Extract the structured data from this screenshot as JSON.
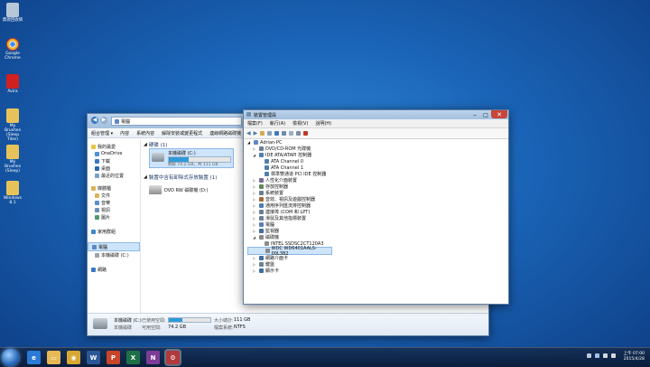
{
  "desktop": {
    "icons": [
      {
        "label": "資源回收筒",
        "color": "#b8c7d8"
      },
      {
        "label": "Google Chrome",
        "color": "#e8b52c"
      },
      {
        "label": "Avira",
        "color": "#d02020"
      },
      {
        "label": "My Brushes (Sleep Tiles)",
        "color": "#e6c35a"
      },
      {
        "label": "My Brushes (Sleep)",
        "color": "#e6c35a"
      },
      {
        "label": "Windows 8.1",
        "color": "#e6c35a"
      }
    ]
  },
  "explorer": {
    "address": "電腦",
    "toolbar": [
      "組合管理 ▾",
      "內容",
      "系統內容",
      "解除安裝或變更程式",
      "連線網路磁碟機"
    ],
    "nav": {
      "favorites": "我的最愛",
      "fav_items": [
        "OneDrive",
        "下載",
        "桌面",
        "最近的位置"
      ],
      "libraries": "媒體櫃",
      "lib_items": [
        "文件",
        "音樂",
        "視訊",
        "圖片"
      ],
      "homegroup": "家用群組",
      "computer": "電腦",
      "computer_items": [
        "本機磁碟 (C:)"
      ],
      "network": "網路"
    },
    "group_hdd": "硬碟 (1)",
    "drive_c": {
      "name": "本機磁碟 (C:)",
      "space": "剩餘 74.2 GB，共 111 GB",
      "used_fraction": 0.33
    },
    "group_removable": "裝置中含有卸除式存放裝置 (1)",
    "dvd": "DVD RW 磁碟機 (D:)",
    "details": {
      "name": "本機磁碟 (C:)",
      "subtitle": "本機磁碟",
      "used_label": "已使用空間:",
      "free_label": "可用空間:",
      "free_value": "74.2 GB",
      "total_label": "大小總計:",
      "total_value": "111 GB",
      "fs_label": "檔案系統:",
      "fs_value": "NTFS"
    }
  },
  "devmgr": {
    "title": "裝置管理員",
    "menus": [
      "檔案(F)",
      "執行(A)",
      "檢視(V)",
      "說明(H)"
    ],
    "root": "Adrian-PC",
    "tree": [
      {
        "label": "DVD/CD-ROM 光碟機",
        "level": 1,
        "exp": "▷",
        "color": "#6a7f95"
      },
      {
        "label": "IDE ATA/ATAPI 控制器",
        "level": 1,
        "exp": "◢",
        "color": "#4f7fb0"
      },
      {
        "label": "ATA Channel 0",
        "level": 2,
        "exp": "",
        "color": "#4f7fb0"
      },
      {
        "label": "ATA Channel 1",
        "level": 2,
        "exp": "",
        "color": "#4f7fb0"
      },
      {
        "label": "標準雙通道 PCI IDE 控制器",
        "level": 2,
        "exp": "",
        "color": "#4f7fb0"
      },
      {
        "label": "人性化介面裝置",
        "level": 1,
        "exp": "▷",
        "color": "#7a6a9a"
      },
      {
        "label": "存放控制器",
        "level": 1,
        "exp": "▷",
        "color": "#5f8a5f"
      },
      {
        "label": "系統裝置",
        "level": 1,
        "exp": "▷",
        "color": "#6a7f95"
      },
      {
        "label": "音效、視訊及遊戲控制器",
        "level": 1,
        "exp": "▷",
        "color": "#a06a3a"
      },
      {
        "label": "通用序列匯流排控制器",
        "level": 1,
        "exp": "▷",
        "color": "#4f7fb0"
      },
      {
        "label": "連接埠 (COM 和 LPT)",
        "level": 1,
        "exp": "▷",
        "color": "#6a7f95"
      },
      {
        "label": "滑鼠及其他指標裝置",
        "level": 1,
        "exp": "▷",
        "color": "#6a7f95"
      },
      {
        "label": "電腦",
        "level": 1,
        "exp": "▷",
        "color": "#5a7fb8"
      },
      {
        "label": "監視器",
        "level": 1,
        "exp": "▷",
        "color": "#3f6fa0"
      },
      {
        "label": "磁碟機",
        "level": 1,
        "exp": "◢",
        "color": "#8a8a8a"
      },
      {
        "label": "INTEL SSDSC2CT120A3",
        "level": 2,
        "exp": "",
        "color": "#8a8a8a"
      },
      {
        "label": "WDC WD6401AALS-00L3B2",
        "level": 2,
        "exp": "",
        "color": "#8a8a8a",
        "selected": true
      },
      {
        "label": "網路介面卡",
        "level": 1,
        "exp": "▷",
        "color": "#3f6fa0"
      },
      {
        "label": "鍵盤",
        "level": 1,
        "exp": "▷",
        "color": "#6a7f95"
      },
      {
        "label": "顯示卡",
        "level": 1,
        "exp": "▷",
        "color": "#3f6fa0"
      }
    ]
  },
  "taskbar": {
    "items": [
      {
        "name": "ie",
        "glyph": "e",
        "color": "#2a7ad6"
      },
      {
        "name": "explorer",
        "glyph": "▭",
        "color": "#e7b955"
      },
      {
        "name": "chrome",
        "glyph": "◉",
        "color": "#d9a832"
      },
      {
        "name": "word",
        "glyph": "W",
        "color": "#2b5797"
      },
      {
        "name": "powerpoint",
        "glyph": "P",
        "color": "#c8452a"
      },
      {
        "name": "excel",
        "glyph": "X",
        "color": "#1e7145"
      },
      {
        "name": "onenote",
        "glyph": "N",
        "color": "#7d3c98"
      },
      {
        "name": "device-manager",
        "glyph": "⚙",
        "color": "#b13a3a"
      }
    ],
    "time": "上午 07:00",
    "date": "2015/4/28"
  }
}
